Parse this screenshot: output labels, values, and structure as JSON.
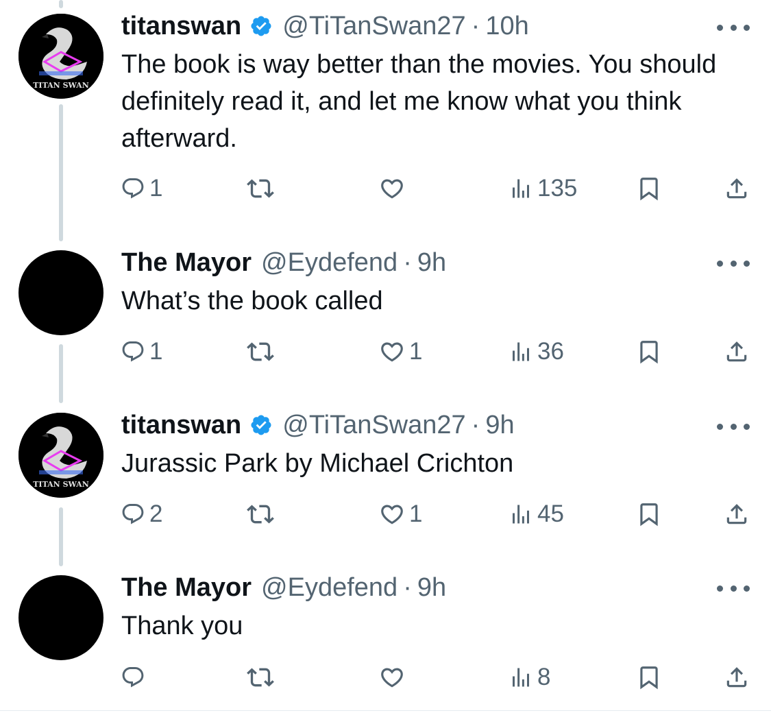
{
  "tweets": [
    {
      "name": "titanswan",
      "verified": true,
      "handle": "@TiTanSwan27",
      "separator": "·",
      "time": "10h",
      "text": "The book is way better than the movies. You should definitely read it, and let me know what you think afterward.",
      "avatar_label": "TITAN SWAN",
      "replies": "1",
      "retweets": "",
      "likes": "",
      "views": "135"
    },
    {
      "name": "The Mayor",
      "verified": false,
      "handle": "@Eydefend",
      "separator": "·",
      "time": "9h",
      "text": "What’s the book called",
      "avatar_label": "",
      "replies": "1",
      "retweets": "",
      "likes": "1",
      "views": "36"
    },
    {
      "name": "titanswan",
      "verified": true,
      "handle": "@TiTanSwan27",
      "separator": "·",
      "time": "9h",
      "text": "Jurassic Park by Michael Crichton",
      "avatar_label": "TITAN SWAN",
      "replies": "2",
      "retweets": "",
      "likes": "1",
      "views": "45"
    },
    {
      "name": "The Mayor",
      "verified": false,
      "handle": "@Eydefend",
      "separator": "·",
      "time": "9h",
      "text": "Thank you",
      "avatar_label": "",
      "replies": "",
      "retweets": "",
      "likes": "",
      "views": "8"
    }
  ],
  "icons": {
    "reply": "reply-icon",
    "retweet": "retweet-icon",
    "like": "heart-icon",
    "views": "views-icon",
    "bookmark": "bookmark-icon",
    "share": "share-icon",
    "more": "more-icon",
    "verified": "verified-badge-icon"
  },
  "colors": {
    "text": "#0f1419",
    "secondary": "#536471",
    "verified": "#1d9bf0",
    "thread_line": "#cfd9de",
    "avatar_bg": "#000000",
    "swan_accent": "#e83cf0"
  }
}
